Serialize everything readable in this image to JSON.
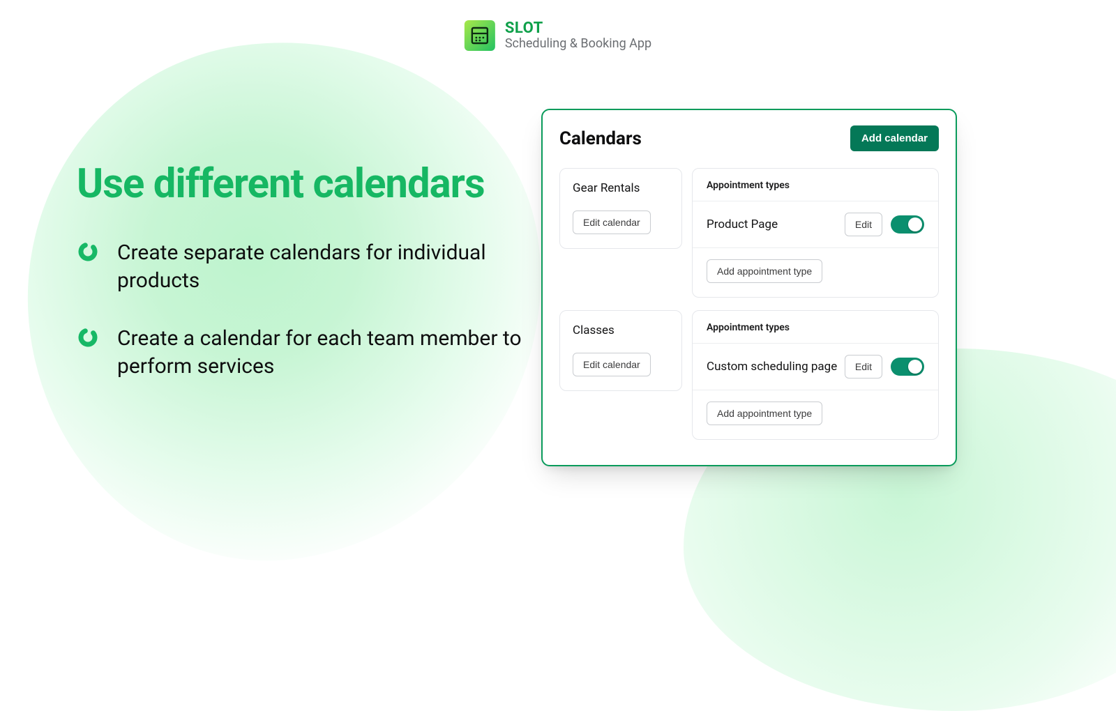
{
  "brand": {
    "name": "SLOT",
    "subtitle": "Scheduling & Booking App"
  },
  "headline": "Use different calendars",
  "bullets": [
    "Create separate calendars for individual products",
    "Create a calendar for each team member to perform services"
  ],
  "panel": {
    "title": "Calendars",
    "add_calendar_label": "Add calendar",
    "edit_calendar_label": "Edit calendar",
    "appointment_types_label": "Appointment types",
    "edit_label": "Edit",
    "add_type_label": "Add appointment type",
    "calendars": [
      {
        "name": "Gear Rentals",
        "type_name": "Product Page",
        "toggle": true
      },
      {
        "name": "Classes",
        "type_name": "Custom scheduling page",
        "toggle": true
      }
    ]
  }
}
